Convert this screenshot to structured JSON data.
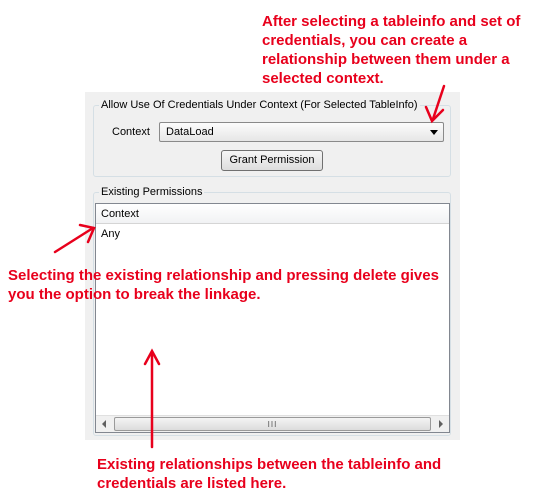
{
  "annotations": {
    "top": "After selecting a tableinfo and set of credentials, you can create a relationship between them under a selected context.",
    "middle": "Selecting the existing relationship and pressing delete gives you the option to break the linkage.",
    "bottom": "Existing relationships between the tableinfo and credentials are listed here.",
    "color": "#e8001c"
  },
  "allow_group": {
    "title": "Allow Use Of Credentials Under Context (For Selected TableInfo)",
    "context_label": "Context",
    "context_value": "DataLoad",
    "grant_button": "Grant Permission"
  },
  "existing_group": {
    "title": "Existing Permissions",
    "columns": [
      "Context"
    ],
    "rows": [
      [
        "Any"
      ]
    ]
  },
  "scrollbar": {
    "grip": "III"
  }
}
